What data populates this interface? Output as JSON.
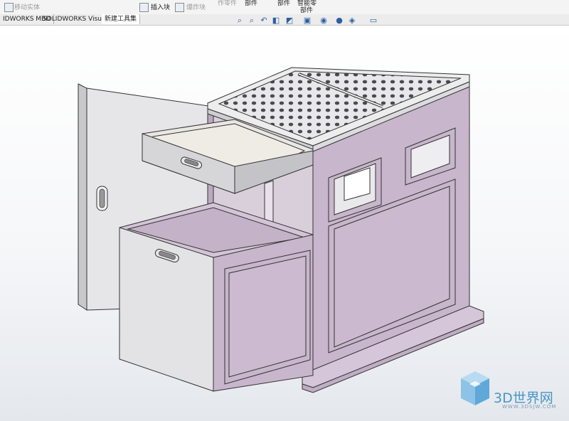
{
  "ribbon": {
    "move_entities": "移动实体",
    "insert_block": "插入块",
    "explode": "爆炸块",
    "make_part": "作零件",
    "part_a": "部件",
    "part_b": "部件",
    "smart_part_line1": "智能零",
    "smart_part_line2": "部件"
  },
  "tabs": [
    {
      "label": "IDWORKS MBD"
    },
    {
      "label": "SOLIDWORKS Visualize"
    },
    {
      "label": "新建工具集"
    }
  ],
  "heads_up_icons": [
    "zoom-to-fit-icon",
    "zoom-area-icon",
    "previous-view-icon",
    "section-view-icon",
    "view-orientation-icon",
    "display-style-icon",
    "hide-show-icon",
    "edit-appearance-icon",
    "apply-scene-icon",
    "view-settings-icon"
  ],
  "watermark": {
    "brand": "3D世界网",
    "url": "WWW.3DSJW.COM"
  },
  "colors": {
    "body_purple": "#c8b6cc",
    "panel_grey": "#dddde0",
    "edge": "#3a3a3a"
  }
}
